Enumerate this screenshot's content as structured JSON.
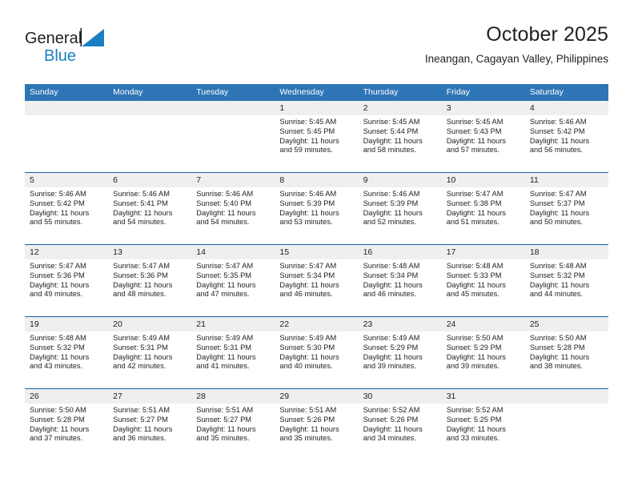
{
  "brand": {
    "name_top": "General",
    "name_bottom": "Blue",
    "top_color": "#231f20",
    "accent_color": "#1a7fc1"
  },
  "header": {
    "title": "October 2025",
    "subtitle": "Ineangan, Cagayan Valley, Philippines"
  },
  "theme": {
    "header_bg": "#2e75b6",
    "header_text": "#ffffff",
    "row_divider": "#1f5fa0",
    "daynum_bg": "#efefef",
    "body_text": "#222222"
  },
  "weekday_headers": [
    "Sunday",
    "Monday",
    "Tuesday",
    "Wednesday",
    "Thursday",
    "Friday",
    "Saturday"
  ],
  "labels": {
    "sunrise": "Sunrise:",
    "sunset": "Sunset:",
    "daylight": "Daylight:"
  },
  "weeks": [
    [
      {
        "day": "",
        "empty": true
      },
      {
        "day": "",
        "empty": true
      },
      {
        "day": "",
        "empty": true
      },
      {
        "day": "1",
        "sunrise": "Sunrise: 5:45 AM",
        "sunset": "Sunset: 5:45 PM",
        "daylight_1": "Daylight: 11 hours",
        "daylight_2": "and 59 minutes."
      },
      {
        "day": "2",
        "sunrise": "Sunrise: 5:45 AM",
        "sunset": "Sunset: 5:44 PM",
        "daylight_1": "Daylight: 11 hours",
        "daylight_2": "and 58 minutes."
      },
      {
        "day": "3",
        "sunrise": "Sunrise: 5:45 AM",
        "sunset": "Sunset: 5:43 PM",
        "daylight_1": "Daylight: 11 hours",
        "daylight_2": "and 57 minutes."
      },
      {
        "day": "4",
        "sunrise": "Sunrise: 5:46 AM",
        "sunset": "Sunset: 5:42 PM",
        "daylight_1": "Daylight: 11 hours",
        "daylight_2": "and 56 minutes."
      }
    ],
    [
      {
        "day": "5",
        "sunrise": "Sunrise: 5:46 AM",
        "sunset": "Sunset: 5:42 PM",
        "daylight_1": "Daylight: 11 hours",
        "daylight_2": "and 55 minutes."
      },
      {
        "day": "6",
        "sunrise": "Sunrise: 5:46 AM",
        "sunset": "Sunset: 5:41 PM",
        "daylight_1": "Daylight: 11 hours",
        "daylight_2": "and 54 minutes."
      },
      {
        "day": "7",
        "sunrise": "Sunrise: 5:46 AM",
        "sunset": "Sunset: 5:40 PM",
        "daylight_1": "Daylight: 11 hours",
        "daylight_2": "and 54 minutes."
      },
      {
        "day": "8",
        "sunrise": "Sunrise: 5:46 AM",
        "sunset": "Sunset: 5:39 PM",
        "daylight_1": "Daylight: 11 hours",
        "daylight_2": "and 53 minutes."
      },
      {
        "day": "9",
        "sunrise": "Sunrise: 5:46 AM",
        "sunset": "Sunset: 5:39 PM",
        "daylight_1": "Daylight: 11 hours",
        "daylight_2": "and 52 minutes."
      },
      {
        "day": "10",
        "sunrise": "Sunrise: 5:47 AM",
        "sunset": "Sunset: 5:38 PM",
        "daylight_1": "Daylight: 11 hours",
        "daylight_2": "and 51 minutes."
      },
      {
        "day": "11",
        "sunrise": "Sunrise: 5:47 AM",
        "sunset": "Sunset: 5:37 PM",
        "daylight_1": "Daylight: 11 hours",
        "daylight_2": "and 50 minutes."
      }
    ],
    [
      {
        "day": "12",
        "sunrise": "Sunrise: 5:47 AM",
        "sunset": "Sunset: 5:36 PM",
        "daylight_1": "Daylight: 11 hours",
        "daylight_2": "and 49 minutes."
      },
      {
        "day": "13",
        "sunrise": "Sunrise: 5:47 AM",
        "sunset": "Sunset: 5:36 PM",
        "daylight_1": "Daylight: 11 hours",
        "daylight_2": "and 48 minutes."
      },
      {
        "day": "14",
        "sunrise": "Sunrise: 5:47 AM",
        "sunset": "Sunset: 5:35 PM",
        "daylight_1": "Daylight: 11 hours",
        "daylight_2": "and 47 minutes."
      },
      {
        "day": "15",
        "sunrise": "Sunrise: 5:47 AM",
        "sunset": "Sunset: 5:34 PM",
        "daylight_1": "Daylight: 11 hours",
        "daylight_2": "and 46 minutes."
      },
      {
        "day": "16",
        "sunrise": "Sunrise: 5:48 AM",
        "sunset": "Sunset: 5:34 PM",
        "daylight_1": "Daylight: 11 hours",
        "daylight_2": "and 46 minutes."
      },
      {
        "day": "17",
        "sunrise": "Sunrise: 5:48 AM",
        "sunset": "Sunset: 5:33 PM",
        "daylight_1": "Daylight: 11 hours",
        "daylight_2": "and 45 minutes."
      },
      {
        "day": "18",
        "sunrise": "Sunrise: 5:48 AM",
        "sunset": "Sunset: 5:32 PM",
        "daylight_1": "Daylight: 11 hours",
        "daylight_2": "and 44 minutes."
      }
    ],
    [
      {
        "day": "19",
        "sunrise": "Sunrise: 5:48 AM",
        "sunset": "Sunset: 5:32 PM",
        "daylight_1": "Daylight: 11 hours",
        "daylight_2": "and 43 minutes."
      },
      {
        "day": "20",
        "sunrise": "Sunrise: 5:49 AM",
        "sunset": "Sunset: 5:31 PM",
        "daylight_1": "Daylight: 11 hours",
        "daylight_2": "and 42 minutes."
      },
      {
        "day": "21",
        "sunrise": "Sunrise: 5:49 AM",
        "sunset": "Sunset: 5:31 PM",
        "daylight_1": "Daylight: 11 hours",
        "daylight_2": "and 41 minutes."
      },
      {
        "day": "22",
        "sunrise": "Sunrise: 5:49 AM",
        "sunset": "Sunset: 5:30 PM",
        "daylight_1": "Daylight: 11 hours",
        "daylight_2": "and 40 minutes."
      },
      {
        "day": "23",
        "sunrise": "Sunrise: 5:49 AM",
        "sunset": "Sunset: 5:29 PM",
        "daylight_1": "Daylight: 11 hours",
        "daylight_2": "and 39 minutes."
      },
      {
        "day": "24",
        "sunrise": "Sunrise: 5:50 AM",
        "sunset": "Sunset: 5:29 PM",
        "daylight_1": "Daylight: 11 hours",
        "daylight_2": "and 39 minutes."
      },
      {
        "day": "25",
        "sunrise": "Sunrise: 5:50 AM",
        "sunset": "Sunset: 5:28 PM",
        "daylight_1": "Daylight: 11 hours",
        "daylight_2": "and 38 minutes."
      }
    ],
    [
      {
        "day": "26",
        "sunrise": "Sunrise: 5:50 AM",
        "sunset": "Sunset: 5:28 PM",
        "daylight_1": "Daylight: 11 hours",
        "daylight_2": "and 37 minutes."
      },
      {
        "day": "27",
        "sunrise": "Sunrise: 5:51 AM",
        "sunset": "Sunset: 5:27 PM",
        "daylight_1": "Daylight: 11 hours",
        "daylight_2": "and 36 minutes."
      },
      {
        "day": "28",
        "sunrise": "Sunrise: 5:51 AM",
        "sunset": "Sunset: 5:27 PM",
        "daylight_1": "Daylight: 11 hours",
        "daylight_2": "and 35 minutes."
      },
      {
        "day": "29",
        "sunrise": "Sunrise: 5:51 AM",
        "sunset": "Sunset: 5:26 PM",
        "daylight_1": "Daylight: 11 hours",
        "daylight_2": "and 35 minutes."
      },
      {
        "day": "30",
        "sunrise": "Sunrise: 5:52 AM",
        "sunset": "Sunset: 5:26 PM",
        "daylight_1": "Daylight: 11 hours",
        "daylight_2": "and 34 minutes."
      },
      {
        "day": "31",
        "sunrise": "Sunrise: 5:52 AM",
        "sunset": "Sunset: 5:25 PM",
        "daylight_1": "Daylight: 11 hours",
        "daylight_2": "and 33 minutes."
      },
      {
        "day": "",
        "empty": true
      }
    ]
  ]
}
